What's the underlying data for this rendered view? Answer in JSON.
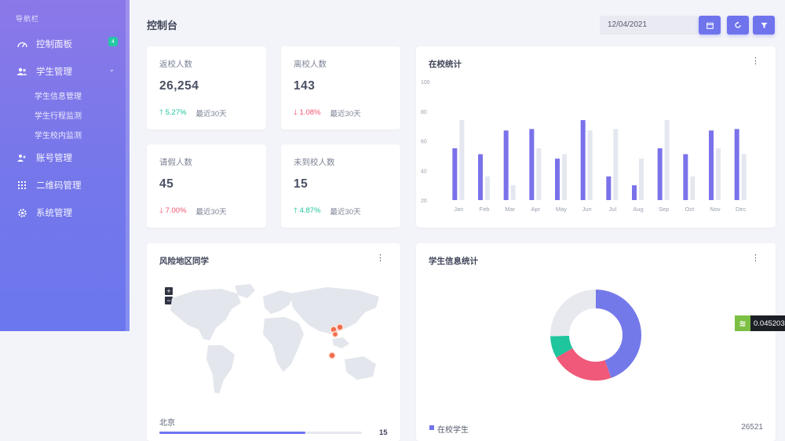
{
  "sidebar": {
    "title": "导航栏",
    "items": [
      {
        "label": "控制面板",
        "badge": "4"
      },
      {
        "label": "学生管理"
      },
      {
        "label": "账号管理"
      },
      {
        "label": "二维码管理"
      },
      {
        "label": "系统管理"
      }
    ],
    "sub_items": [
      "学生信息管理",
      "学生行程监测",
      "学生校内监测"
    ]
  },
  "header": {
    "title": "控制台",
    "date": "12/04/2021"
  },
  "stats": [
    {
      "label": "返校人数",
      "value": "26,254",
      "change": "5.27%",
      "trend": "up",
      "period": "最近30天"
    },
    {
      "label": "离校人数",
      "value": "143",
      "change": "1.08%",
      "trend": "down",
      "period": "最近30天"
    },
    {
      "label": "请假人数",
      "value": "45",
      "change": "7.00%",
      "trend": "down",
      "period": "最近30天"
    },
    {
      "label": "未到校人数",
      "value": "15",
      "change": "4.87%",
      "trend": "up",
      "period": "最近30天"
    }
  ],
  "bar_card": {
    "title": "在校统计"
  },
  "map_card": {
    "title": "风险地区同学",
    "region_label": "北京",
    "region_value": "15",
    "progress": 0.72
  },
  "donut_card": {
    "title": "学生信息统计",
    "legend_label": "在校学生",
    "legend_value": "26521"
  },
  "float_widget": {
    "value": "0.045203"
  },
  "colors": {
    "accent": "#6f74ed",
    "up": "#1fc59d",
    "down": "#f1546e",
    "pink": "#f0597a",
    "teal": "#1fc59d",
    "gray": "#e7e9ef"
  },
  "chart_data": [
    {
      "type": "bar",
      "categories": [
        "Jan",
        "Feb",
        "Mar",
        "Apr",
        "May",
        "Jun",
        "Jul",
        "Aug",
        "Sep",
        "Oct",
        "Nov",
        "Dec"
      ],
      "yticks": [
        "100",
        "80",
        "60",
        "40",
        "20"
      ],
      "ylim": [
        20,
        100
      ],
      "series": [
        {
          "color": "#7a72ea",
          "values": [
            55,
            51,
            67,
            68,
            48,
            74,
            36,
            30,
            55,
            51,
            67,
            68
          ]
        },
        {
          "color": "#e4e7ef",
          "values": [
            74,
            36,
            30,
            55,
            51,
            67,
            68,
            48,
            74,
            36,
            55,
            51
          ]
        }
      ]
    },
    {
      "type": "pie",
      "slices": [
        {
          "color": "#7479ea",
          "value": 40
        },
        {
          "color": "#f0597a",
          "value": 20
        },
        {
          "color": "#1fc59d",
          "value": 7
        },
        {
          "color": "#e7e9ef",
          "value": 23
        }
      ]
    }
  ]
}
